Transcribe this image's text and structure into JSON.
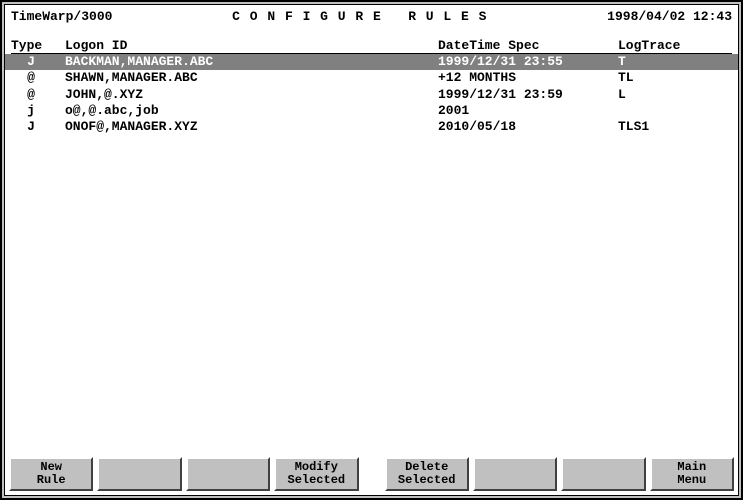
{
  "app_title": "TimeWarp/3000",
  "screen_title": "C O N F I G U R E   R U L E S",
  "timestamp": "1998/04/02 12:43",
  "columns": {
    "type": "Type",
    "logon": "Logon ID",
    "datetime": "DateTime Spec",
    "logtrace": "LogTrace"
  },
  "rules": [
    {
      "type": "J",
      "logon": "BACKMAN,MANAGER.ABC",
      "datetime": "1999/12/31 23:55",
      "logtrace": "T",
      "selected": true
    },
    {
      "type": "@",
      "logon": "SHAWN,MANAGER.ABC",
      "datetime": "+12 MONTHS",
      "logtrace": "TL",
      "selected": false
    },
    {
      "type": "@",
      "logon": "JOHN,@.XYZ",
      "datetime": "1999/12/31 23:59",
      "logtrace": "L",
      "selected": false
    },
    {
      "type": "j",
      "logon": "o@,@.abc,job",
      "datetime": "2001",
      "logtrace": "",
      "selected": false
    },
    {
      "type": "J",
      "logon": "ONOF@,MANAGER.XYZ",
      "datetime": "2010/05/18",
      "logtrace": "TLS1",
      "selected": false
    }
  ],
  "buttons": {
    "f1": "New\nRule",
    "f2": "",
    "f3": "",
    "f4": "Modify\nSelected",
    "f5": "Delete\nSelected",
    "f6": "",
    "f7": "",
    "f8": "Main\nMenu"
  }
}
